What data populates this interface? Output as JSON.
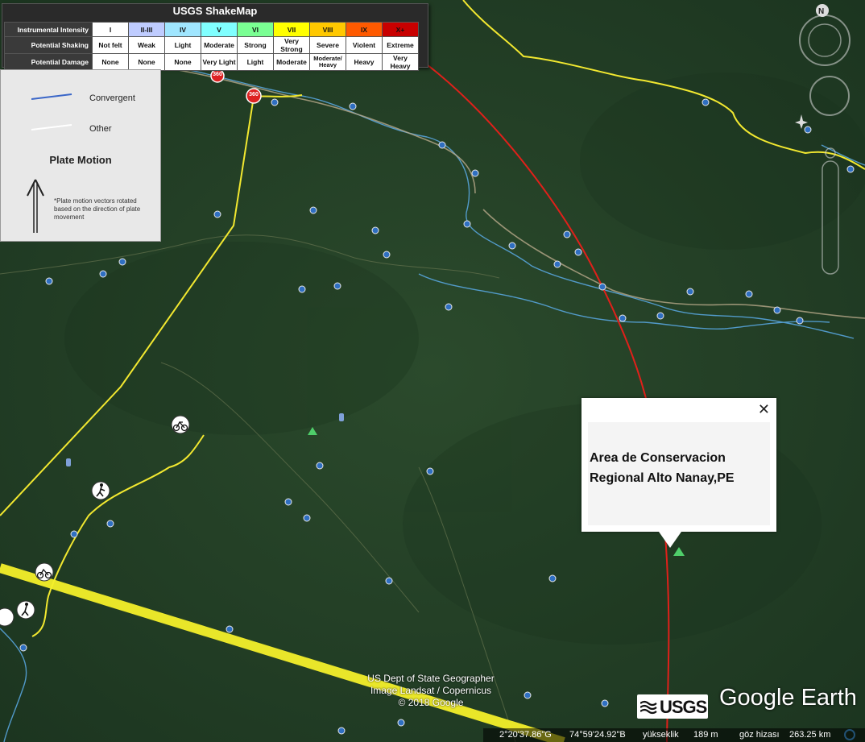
{
  "shakemap": {
    "title": "USGS ShakeMap",
    "rows": [
      {
        "label": "Instrumental Intensity",
        "cells": [
          "I",
          "II-III",
          "IV",
          "V",
          "VI",
          "VII",
          "VIII",
          "IX",
          "X+"
        ]
      },
      {
        "label": "Potential Shaking",
        "cells": [
          "Not felt",
          "Weak",
          "Light",
          "Moderate",
          "Strong",
          "Very Strong",
          "Severe",
          "Violent",
          "Extreme"
        ]
      },
      {
        "label": "Potential Damage",
        "cells": [
          "None",
          "None",
          "None",
          "Very Light",
          "Light",
          "Moderate",
          "Moderate/ Heavy",
          "Heavy",
          "Very Heavy"
        ]
      }
    ],
    "intensity_colors": [
      "#ffffff",
      "#bfccff",
      "#a0e6ff",
      "#80ffff",
      "#7aff93",
      "#ffff00",
      "#ffc800",
      "#ff5a00",
      "#c80000"
    ]
  },
  "plate_legend": {
    "convergent_label": "Convergent",
    "other_label": "Other",
    "motion_title": "Plate Motion",
    "note": "*Plate motion vectors rotated based on the direction of plate movement"
  },
  "popup": {
    "line1": "Area de Conservacion",
    "line2": "Regional Alto Nanay,PE",
    "close_label": "✕"
  },
  "road_badges": [
    "360",
    "360"
  ],
  "attribution": {
    "line1": "US Dept of State Geographer",
    "line2": "Image Landsat / Copernicus",
    "line3": "© 2018 Google"
  },
  "status": {
    "lat": "2°20'37.86\"G",
    "lon": "74°59'24.92\"B",
    "elev_label": "yükseklik",
    "elev": "189 m",
    "eye_label": "göz hizası",
    "eye": "263.25 km"
  },
  "logos": {
    "usgs": "USGS",
    "google_earth": "Google Earth"
  },
  "nav": {
    "north": "N"
  },
  "colors": {
    "fault_red": "#e0201a",
    "border_yellow": "#f2e830",
    "river_blue": "#5aaae6",
    "convergent": "#3a66c8"
  }
}
